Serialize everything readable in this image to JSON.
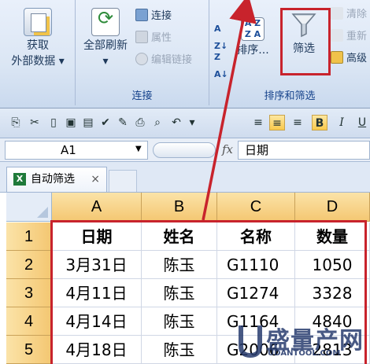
{
  "ribbon": {
    "get_external": {
      "line1": "获取",
      "line2": "外部数据"
    },
    "refresh_all": "全部刷新",
    "connections": "连接",
    "properties": "属性",
    "edit_links": "编辑链接",
    "group_connections": "连接",
    "sort_label": "排序...",
    "filter_label": "筛选",
    "clear_label": "清除",
    "reapply_label": "重新",
    "advanced_label": "高级",
    "group_sort_filter": "排序和筛选"
  },
  "formula_bar": {
    "name_box": "A1",
    "fx": "fx",
    "content": "日期"
  },
  "workbook_tab": {
    "name": "自动筛选",
    "close": "×"
  },
  "grid": {
    "columns": [
      "A",
      "B",
      "C",
      "D"
    ],
    "rows": [
      "1",
      "2",
      "3",
      "4",
      "5"
    ],
    "cells": [
      [
        "日期",
        "姓名",
        "名称",
        "数量"
      ],
      [
        "3月31日",
        "陈玉",
        "G1110",
        "1050"
      ],
      [
        "4月11日",
        "陈玉",
        "G1274",
        "3328"
      ],
      [
        "4月14日",
        "陈玉",
        "G1164",
        "4840"
      ],
      [
        "4月18日",
        "陈玉",
        "G2006",
        "2813"
      ]
    ]
  },
  "watermark": {
    "text": "盛量产网",
    "url": "UDANTOOL.COM"
  },
  "colors": {
    "annotation": "#c8232c",
    "header_fill": "#f4c772",
    "ribbon_bg": "#dfe8f5"
  }
}
